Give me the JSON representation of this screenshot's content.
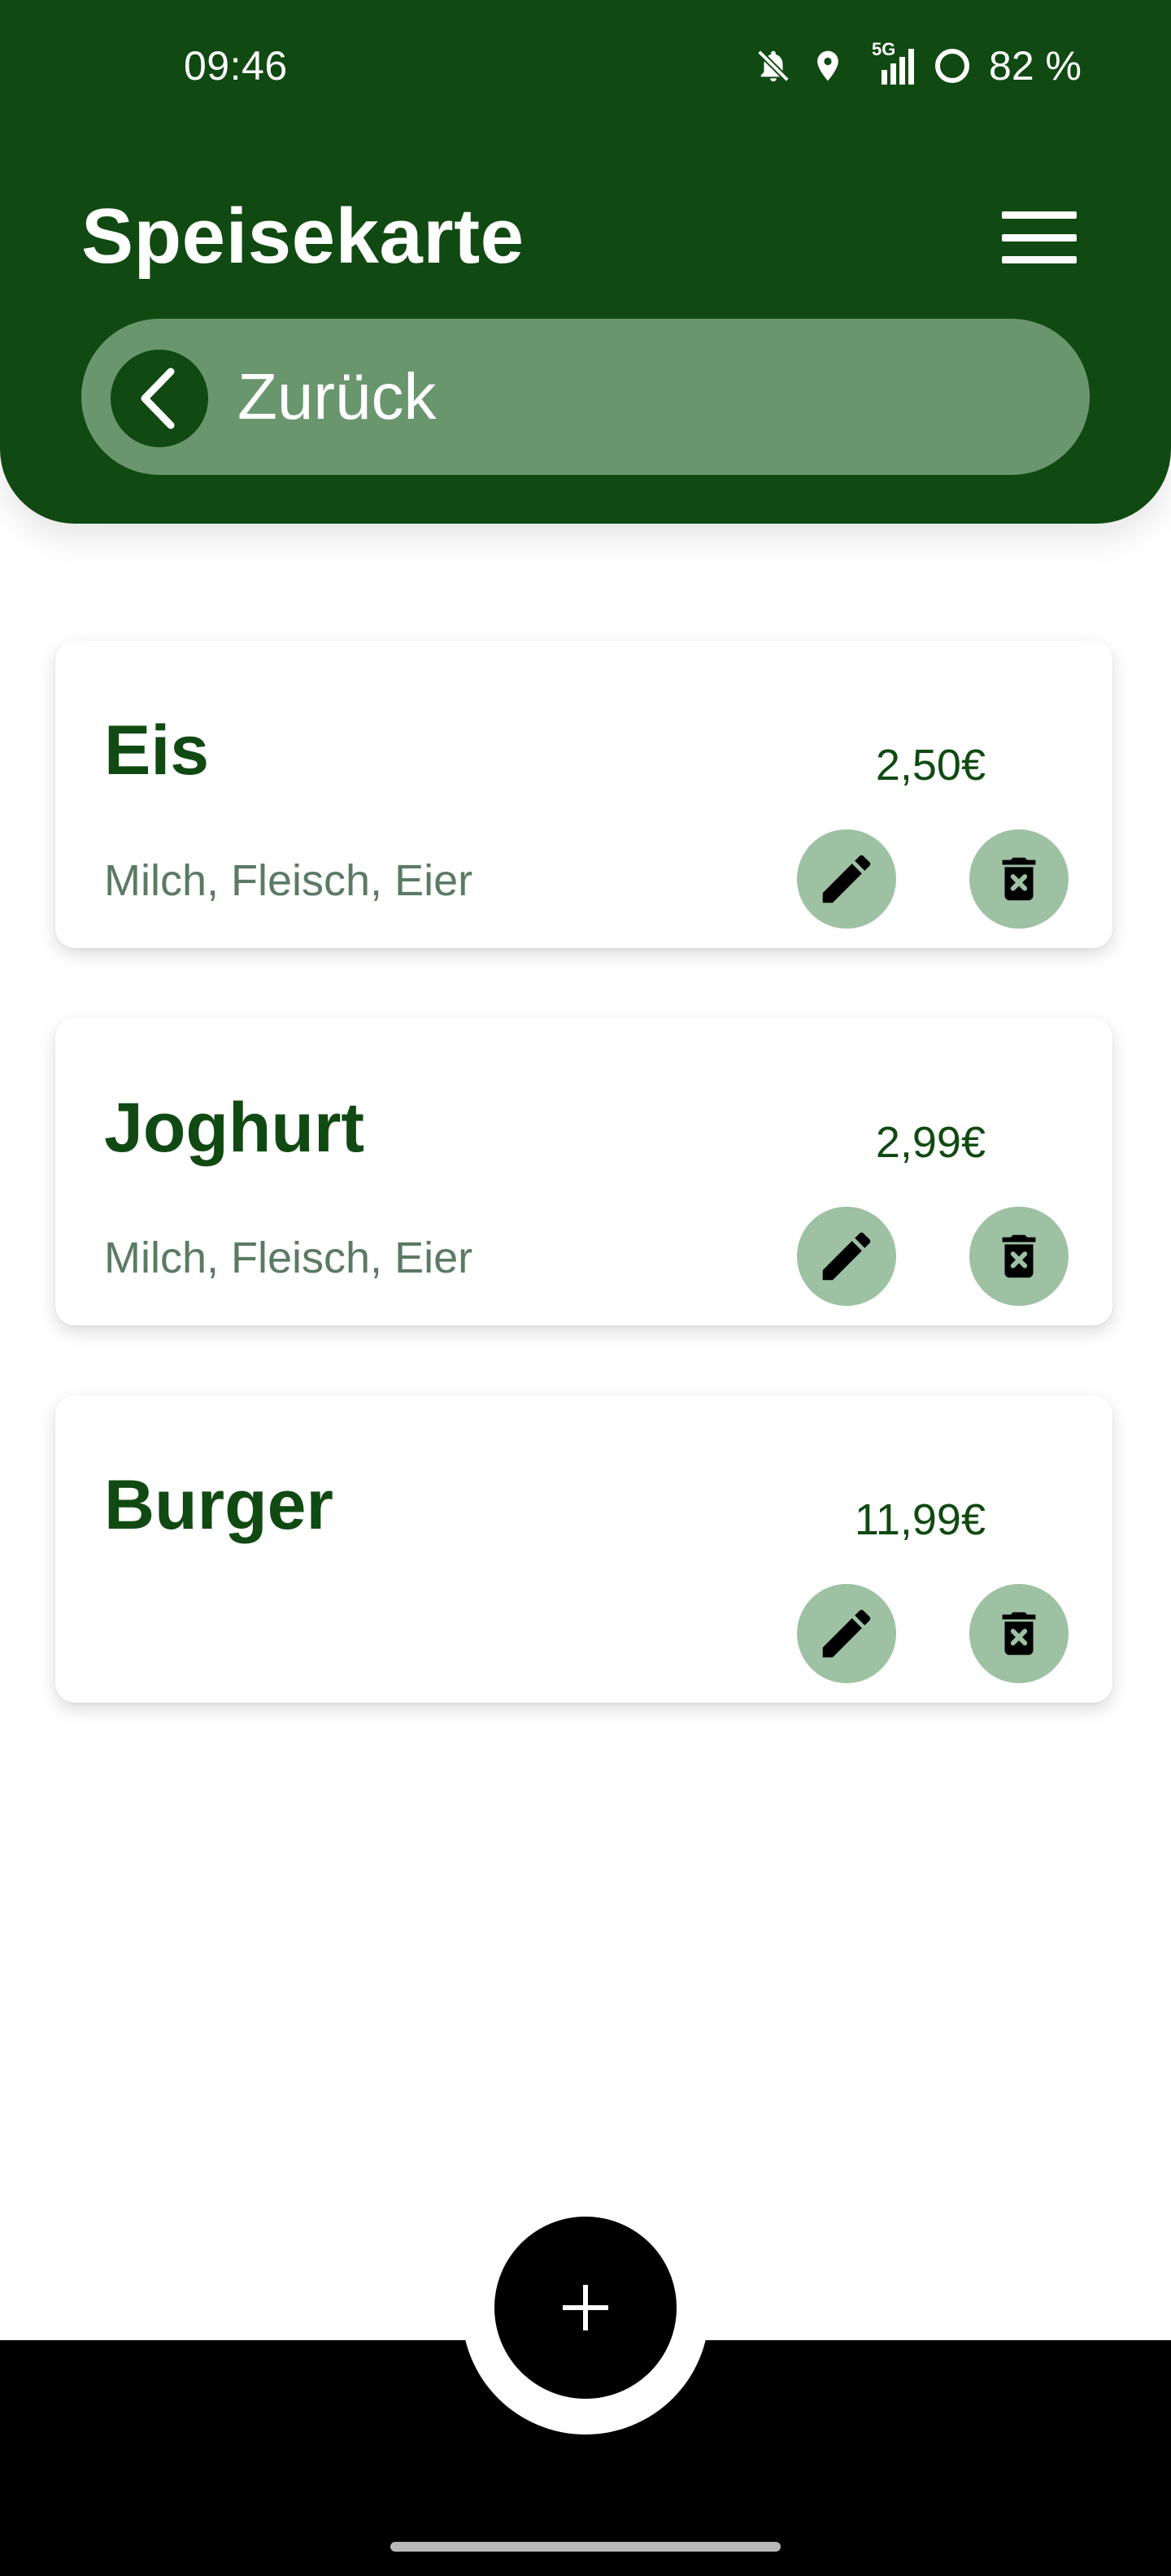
{
  "status_bar": {
    "time": "09:46",
    "network": "5G",
    "battery": "82 %",
    "icons": [
      "bell-off-icon",
      "location-icon",
      "signal-5g-icon",
      "battery-ring-icon"
    ]
  },
  "header": {
    "title": "Speisekarte",
    "menu_icon": "hamburger-menu-icon",
    "back_label": "Zurück",
    "back_icon": "chevron-left-icon"
  },
  "menu_items": [
    {
      "name": "Eis",
      "price": "2,50€",
      "description": "Milch, Fleisch, Eier"
    },
    {
      "name": "Joghurt",
      "price": "2,99€",
      "description": "Milch, Fleisch, Eier"
    },
    {
      "name": "Burger",
      "price": "11,99€",
      "description": ""
    }
  ],
  "actions": {
    "edit_icon": "pencil-icon",
    "delete_icon": "trash-icon",
    "add_icon": "plus-icon"
  },
  "colors": {
    "primary_green": "#104a12",
    "pill_green": "#6a966e",
    "button_green": "#9dc1a2",
    "description_gray": "#5b7a63"
  }
}
